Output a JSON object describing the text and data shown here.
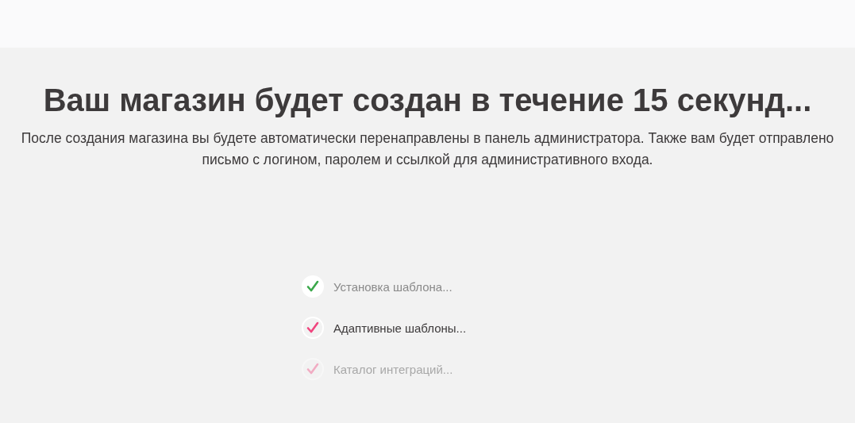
{
  "title": "Ваш магазин будет создан в течение 15 секунд...",
  "description": "После создания магазина вы будете автоматически перенаправлены в панель администратора. Также вам будет отправлено письмо с логином, паролем и ссылкой для административного входа.",
  "steps": [
    {
      "label": "Установка шаблона...",
      "completed": true,
      "selected": false
    },
    {
      "label": "Адаптивные шаблоны...",
      "completed": false,
      "selected": true
    },
    {
      "label": "Каталог интеграций...",
      "completed": false,
      "selected": false
    }
  ]
}
